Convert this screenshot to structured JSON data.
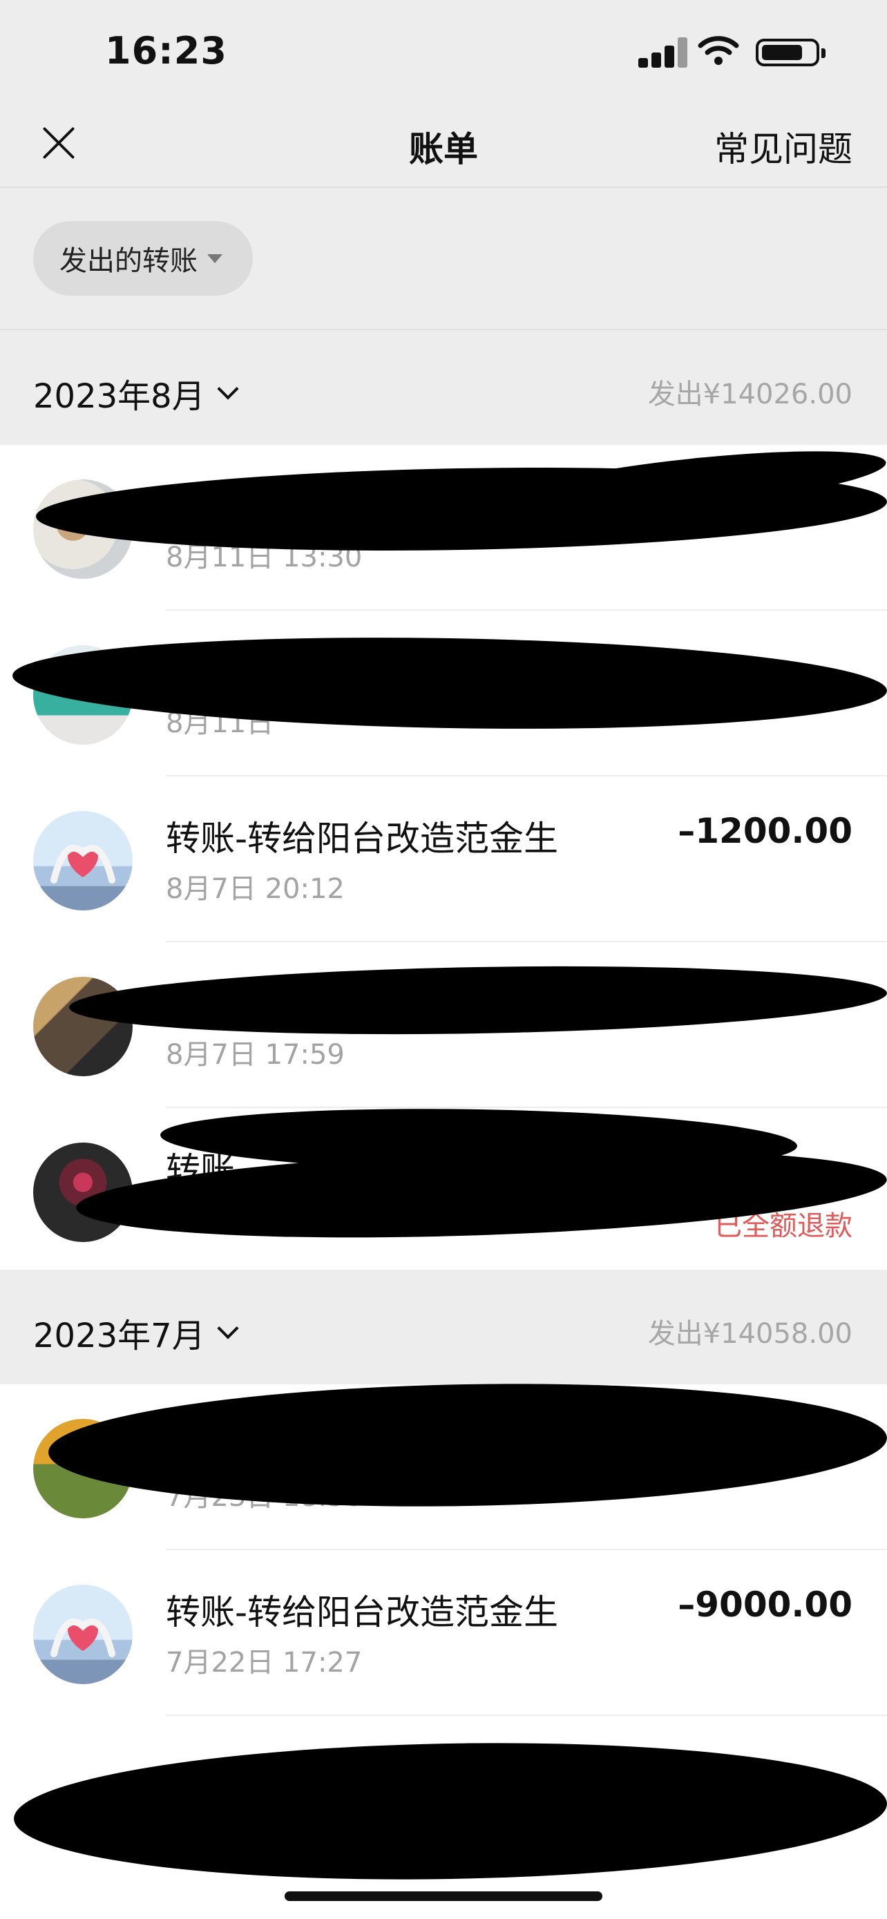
{
  "status_bar": {
    "time": "16:23"
  },
  "nav": {
    "title": "账单",
    "right_link": "常见问题"
  },
  "filter": {
    "label": "发出的转账"
  },
  "months": [
    {
      "label": "2023年8月",
      "total": "发出¥14026.00",
      "items": [
        {
          "title": "",
          "time": "8月11日 13:30",
          "amount": "",
          "status": ""
        },
        {
          "title": "",
          "time": "8月11日",
          "amount": "",
          "status": ""
        },
        {
          "title": "转账-转给阳台改造范金生",
          "time": "8月7日 20:12",
          "amount": "–1200.00",
          "status": ""
        },
        {
          "title": "",
          "time": "8月7日 17:59",
          "amount": "",
          "status": ""
        },
        {
          "title": "转账",
          "time": "",
          "amount": "",
          "status": "已全额退款"
        }
      ]
    },
    {
      "label": "2023年7月",
      "total": "发出¥14058.00",
      "items": [
        {
          "title": "",
          "time": "7月23日 18:36",
          "amount": "",
          "status": ""
        },
        {
          "title": "转账-转给阳台改造范金生",
          "time": "7月22日 17:27",
          "amount": "–9000.00",
          "status": ""
        },
        {
          "title": "",
          "time": "",
          "amount": "",
          "status": ""
        }
      ]
    }
  ]
}
